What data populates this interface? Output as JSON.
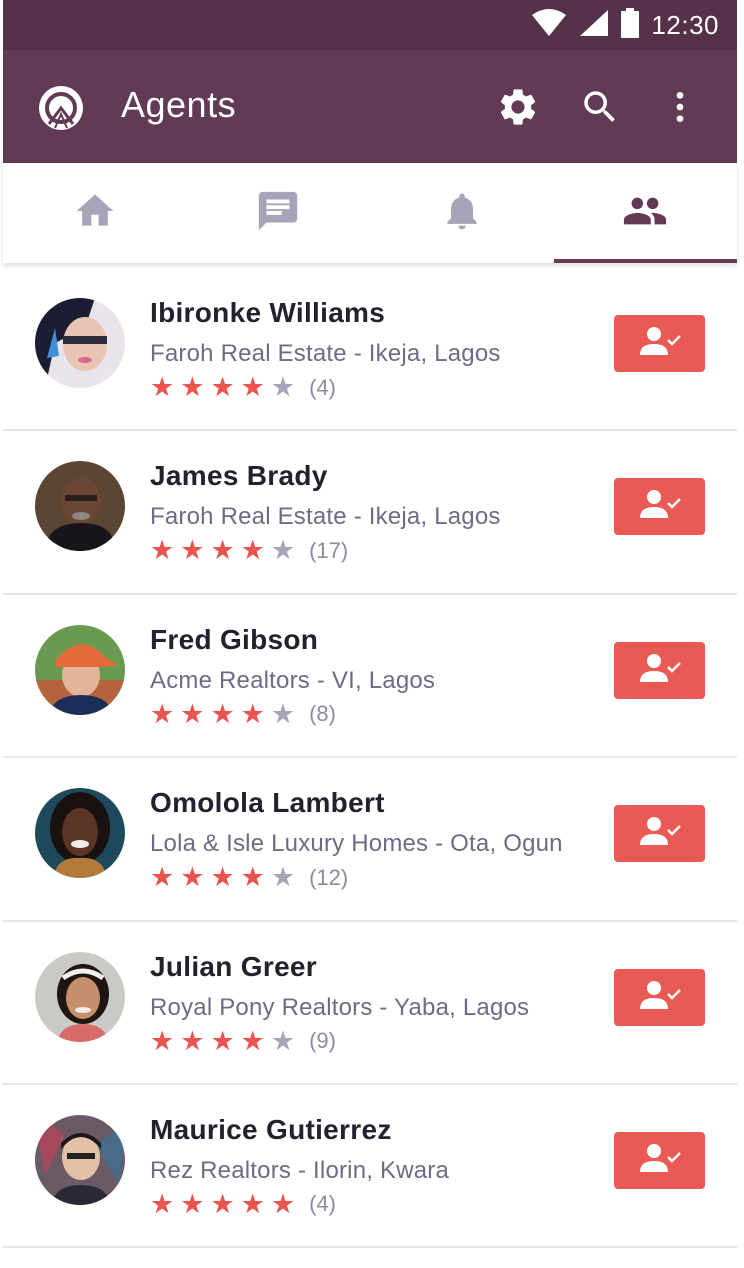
{
  "status_bar": {
    "time": "12:30",
    "icons": [
      "wifi-icon",
      "signal-icon",
      "battery-icon"
    ]
  },
  "app_bar": {
    "title": "Agents",
    "logo": "app-logo",
    "actions": [
      "settings-icon",
      "search-icon",
      "more-vert-icon"
    ]
  },
  "tabs": [
    {
      "name": "home",
      "icon": "home-icon",
      "active": false
    },
    {
      "name": "messages",
      "icon": "message-icon",
      "active": false
    },
    {
      "name": "notifications",
      "icon": "bell-icon",
      "active": false
    },
    {
      "name": "agents",
      "icon": "people-icon",
      "active": true
    }
  ],
  "agents": [
    {
      "name": "Ibironke Williams",
      "company": "Faroh Real Estate - Ikeja, Lagos",
      "rating": 4,
      "count": "(4)"
    },
    {
      "name": "James Brady",
      "company": "Faroh Real Estate - Ikeja, Lagos",
      "rating": 4,
      "count": "(17)"
    },
    {
      "name": "Fred Gibson",
      "company": "Acme Realtors - VI, Lagos",
      "rating": 4,
      "count": "(8)"
    },
    {
      "name": "Omolola Lambert",
      "company": "Lola & Isle Luxury Homes - Ota, Ogun",
      "rating": 4,
      "count": "(12)"
    },
    {
      "name": "Julian Greer",
      "company": "Royal Pony Realtors - Yaba, Lagos",
      "rating": 4,
      "count": "(9)"
    },
    {
      "name": "Maurice Gutierrez",
      "company": "Rez Realtors - Ilorin, Kwara",
      "rating": 5,
      "count": "(4)"
    }
  ],
  "colors": {
    "status_bar": "#55314a",
    "app_bar": "#613a56",
    "accent": "#ea5a55",
    "star_off": "#a6a5b8",
    "tab_icon": "#a6a5b8",
    "tab_icon_active": "#613a56"
  }
}
